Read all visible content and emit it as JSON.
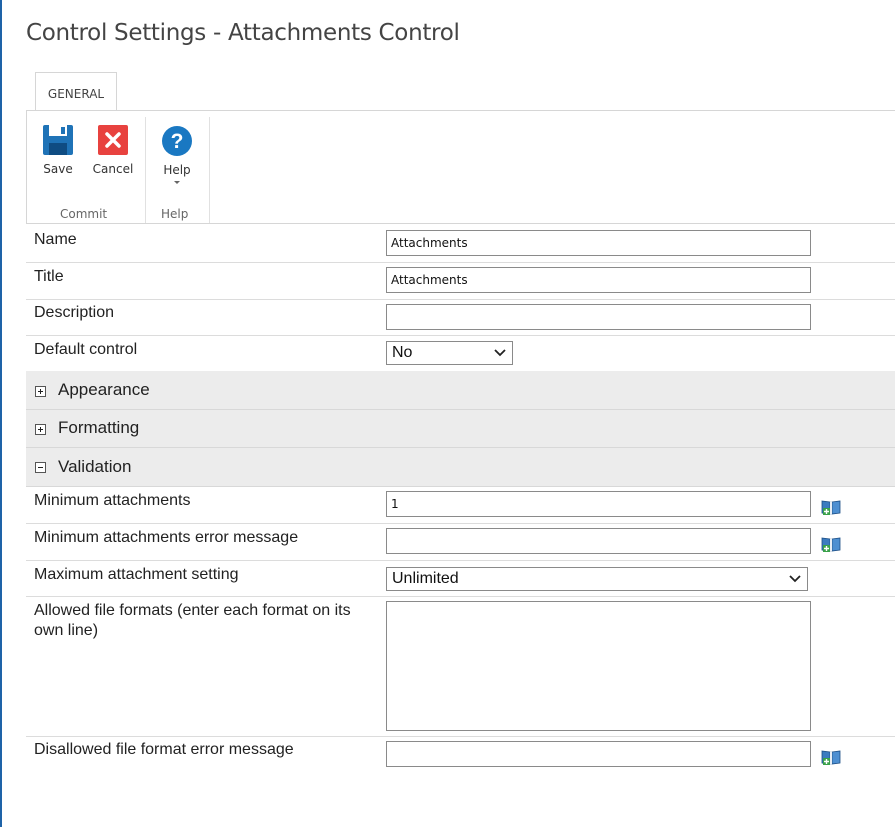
{
  "header": {
    "title": "Control Settings - Attachments Control"
  },
  "ribbon": {
    "tab": "GENERAL",
    "buttons": {
      "save": "Save",
      "cancel": "Cancel",
      "help": "Help"
    },
    "groups": {
      "commit": "Commit",
      "help": "Help"
    },
    "icons": {
      "save": "save-icon",
      "cancel": "cancel-icon",
      "help": "help-icon"
    }
  },
  "fields": {
    "name": {
      "label": "Name",
      "value": "Attachments"
    },
    "title": {
      "label": "Title",
      "value": "Attachments"
    },
    "description": {
      "label": "Description",
      "value": ""
    },
    "default_control": {
      "label": "Default control",
      "value": "No"
    }
  },
  "sections": {
    "appearance": "Appearance",
    "formatting": "Formatting",
    "validation": "Validation"
  },
  "validation": {
    "min_attachments": {
      "label": "Minimum attachments",
      "value": "1"
    },
    "min_attachments_error": {
      "label": "Minimum attachments error message",
      "value": ""
    },
    "max_attachment_setting": {
      "label": "Maximum attachment setting",
      "value": "Unlimited"
    },
    "allowed_formats": {
      "label": "Allowed file formats (enter each format on its own line)",
      "value": ""
    },
    "disallowed_error": {
      "label": "Disallowed file format error message",
      "value": ""
    }
  },
  "colors": {
    "save_blue": "#1f73b7",
    "cancel_red": "#e8423f",
    "help_blue": "#1a78c2",
    "accent_edge": "#1e63a8"
  }
}
